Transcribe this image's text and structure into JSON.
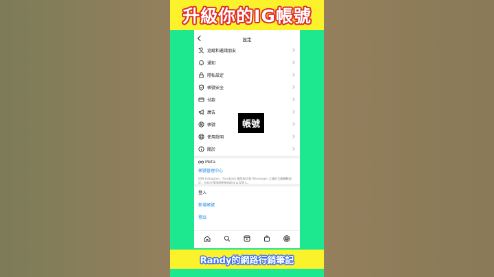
{
  "banner": {
    "top_title": "升級你的IG帳號",
    "bottom_title": "Randy的網路行銷筆記"
  },
  "overlay": {
    "label": "帳號"
  },
  "screen": {
    "title": "設定",
    "menu_items": [
      {
        "label": "追蹤和邀請朋友",
        "icon": "add-person-icon"
      },
      {
        "label": "通知",
        "icon": "bell-icon"
      },
      {
        "label": "隱私設定",
        "icon": "lock-icon"
      },
      {
        "label": "帳號安全",
        "icon": "shield-icon"
      },
      {
        "label": "付款",
        "icon": "card-icon"
      },
      {
        "label": "廣告",
        "icon": "megaphone-icon"
      },
      {
        "label": "帳號",
        "icon": "account-icon"
      },
      {
        "label": "使用說明",
        "icon": "help-lifebuoy-icon"
      },
      {
        "label": "關於",
        "icon": "info-icon"
      }
    ],
    "meta": {
      "logo": "Meta",
      "accounts_center": "帳號管理中心",
      "description": "控制 Instagram、Facebook 應用程式和 Messenger 之間的互聯體驗設定，包括分享限時動態和貼文以及登入。"
    },
    "login_section": "登入",
    "add_account": "新增帳號",
    "logout": "登出"
  },
  "colors": {
    "panel_green": "#1de88f",
    "banner_yellow": "#fbf22b",
    "link_blue": "#1e88e5",
    "title_stroke": "#e02a2a",
    "subtitle_stroke": "#3a6df0"
  }
}
